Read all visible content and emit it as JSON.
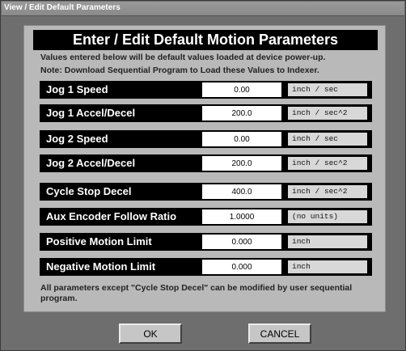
{
  "window": {
    "title": "View / Edit Default Parameters"
  },
  "header": {
    "title": "Enter / Edit Default Motion Parameters"
  },
  "notes": {
    "line1": "Values entered below will be default values loaded at device power-up.",
    "line2": "Note:  Download Sequential Program to Load these Values to Indexer."
  },
  "params": [
    {
      "label": "Jog 1 Speed",
      "value": "0.00",
      "unit": "inch / sec"
    },
    {
      "label": "Jog 1 Accel/Decel",
      "value": "200.0",
      "unit": "inch / sec^2"
    },
    {
      "label": "Jog 2 Speed",
      "value": "0.00",
      "unit": "inch / sec"
    },
    {
      "label": "Jog 2 Accel/Decel",
      "value": "200.0",
      "unit": "inch / sec^2"
    },
    {
      "label": "Cycle Stop Decel",
      "value": "400.0",
      "unit": "inch / sec^2"
    },
    {
      "label": "Aux Encoder Follow Ratio",
      "value": "1.0000",
      "unit": "(no units)"
    },
    {
      "label": "Positive Motion Limit",
      "value": "0.000",
      "unit": "inch"
    },
    {
      "label": "Negative Motion Limit",
      "value": "0.000",
      "unit": "inch"
    }
  ],
  "footer_note": "All parameters except \"Cycle Stop Decel\" can be modified by user sequential program.",
  "buttons": {
    "ok": "OK",
    "cancel": "CANCEL"
  }
}
